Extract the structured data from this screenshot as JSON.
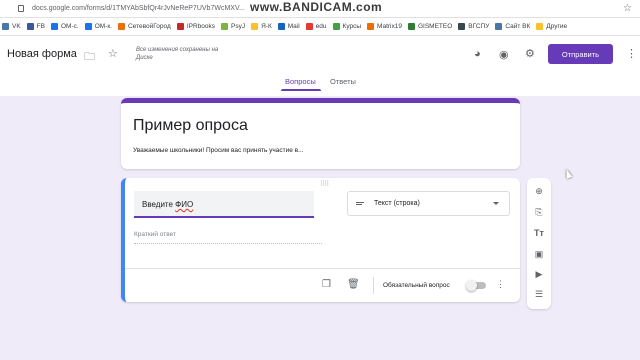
{
  "browser": {
    "url": "docs.google.com/forms/d/1TMYAbSbfQr4rJvNeReP7UVb7WcMXV...",
    "watermark": "www.BANDICAM.com",
    "bookmarks": [
      {
        "label": "VK",
        "color": "#4a76a8"
      },
      {
        "label": "FB",
        "color": "#3b5998"
      },
      {
        "label": "OM-c.",
        "color": "#1a73e8"
      },
      {
        "label": "OM-к.",
        "color": "#1a73e8"
      },
      {
        "label": "СетевойГород",
        "color": "#e8710a"
      },
      {
        "label": "IPRbooks",
        "color": "#c62828"
      },
      {
        "label": "PsyJ",
        "color": "#7cb342"
      },
      {
        "label": "Я-К",
        "color": "#fbc02d"
      },
      {
        "label": "Mail",
        "color": "#1565c0"
      },
      {
        "label": "edu",
        "color": "#e53935"
      },
      {
        "label": "Курсы",
        "color": "#43a047"
      },
      {
        "label": "Matrix19",
        "color": "#ef6c00"
      },
      {
        "label": "GISMETEO",
        "color": "#2e7d32"
      },
      {
        "label": "ВГСПУ",
        "color": "#37474f"
      },
      {
        "label": "Сайт ВК",
        "color": "#4a76a8"
      },
      {
        "label": "Другие",
        "color": "#fbc02d"
      }
    ]
  },
  "header": {
    "form_name": "Новая форма",
    "saved_status": "Все изменения сохранены на Диске",
    "send_label": "Отправить"
  },
  "tabs": [
    {
      "label": "Вопросы",
      "active": true
    },
    {
      "label": "Ответы",
      "active": false
    }
  ],
  "form": {
    "title": "Пример опроса",
    "description": "Уважаемые школьники! Просим вас принять участие в..."
  },
  "question": {
    "text_prefix": "Введите ",
    "text_misspelled": "ФИО",
    "type_label": "Текст (строка)",
    "answer_placeholder": "Краткий ответ",
    "required_label": "Обязательный вопрос",
    "required": false
  },
  "accent_color": "#673ab7"
}
